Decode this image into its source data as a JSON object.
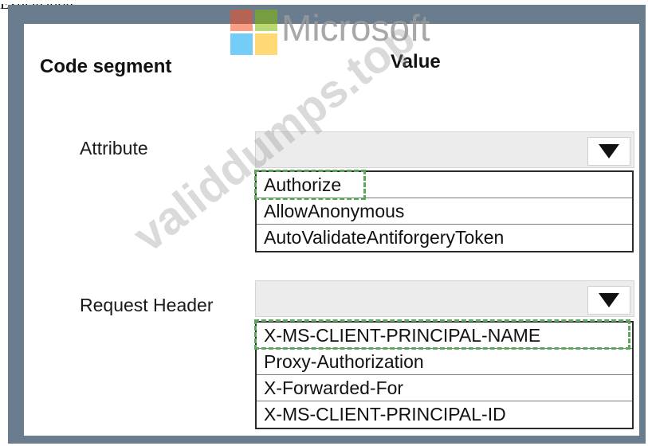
{
  "top_fragment": "Explanation:",
  "branding": {
    "logo_text": "Microsoft",
    "watermark_text": "validdumps.top"
  },
  "headers": {
    "code_segment": "Code segment",
    "value": "Value"
  },
  "rows": [
    {
      "label": "Attribute",
      "selected_value": "",
      "options": [
        "Authorize",
        "AllowAnonymous",
        "AutoValidateAntiforgeryToken"
      ],
      "highlighted_option": "Authorize"
    },
    {
      "label": "Request Header",
      "selected_value": "",
      "options": [
        "X-MS-CLIENT-PRINCIPAL-NAME",
        "Proxy-Authorization",
        "X-Forwarded-For",
        "X-MS-CLIENT-PRINCIPAL-ID"
      ],
      "highlighted_option": "X-MS-CLIENT-PRINCIPAL-NAME"
    }
  ],
  "colors": {
    "frame": "#6a7d8e",
    "highlight_dash": "#5aa85a",
    "logo_red": "#f25022",
    "logo_green": "#7fba00",
    "logo_blue": "#00a4ef",
    "logo_yellow": "#ffb900"
  },
  "icons": {
    "dropdown_arrow": "triangle-down-icon"
  }
}
